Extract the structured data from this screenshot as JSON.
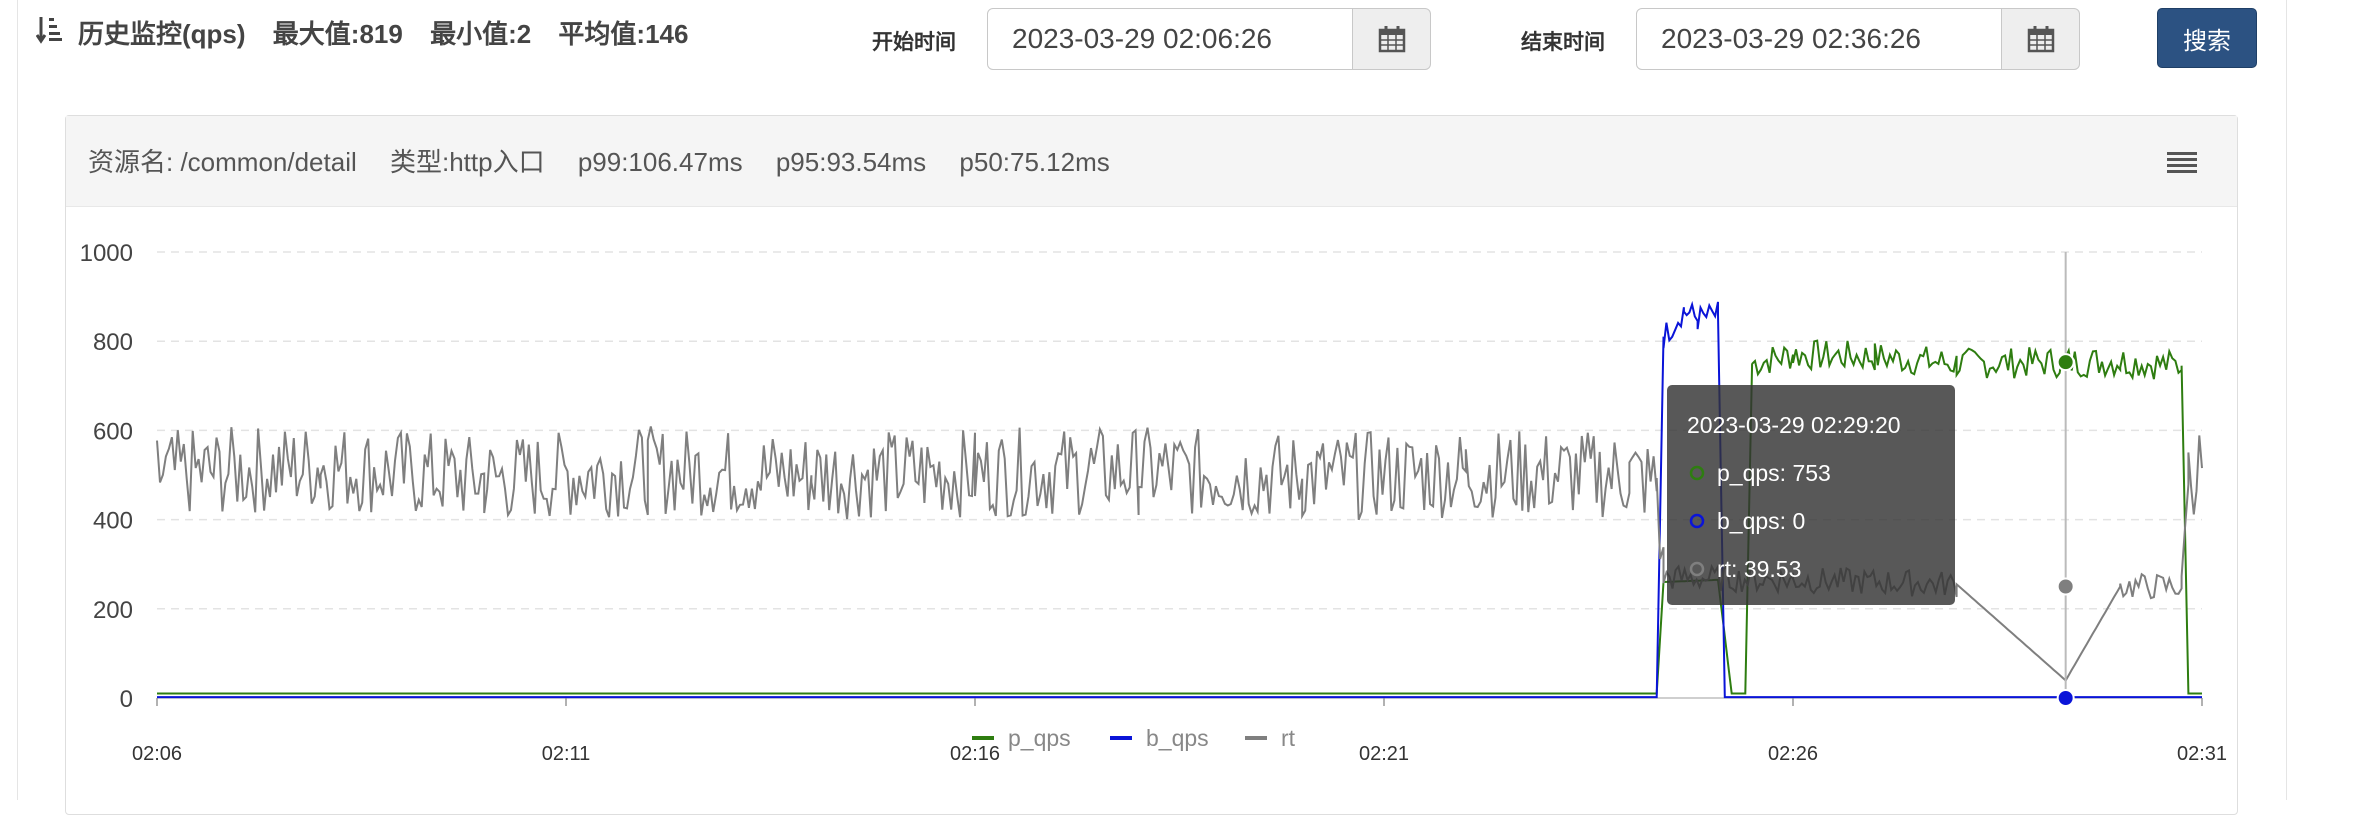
{
  "header": {
    "title": "历史监控(qps)",
    "max_label": "最大值:819",
    "min_label": "最小值:2",
    "avg_label": "平均值:146"
  },
  "filters": {
    "start_label": "开始时间",
    "start_value": "2023-03-29 02:06:26",
    "end_label": "结束时间",
    "end_value": "2023-03-29 02:36:26",
    "search_label": "搜索"
  },
  "card": {
    "resource": "资源名: /common/detail",
    "type": "类型:http入口",
    "p99": "p99:106.47ms",
    "p95": "p95:93.54ms",
    "p50": "p50:75.12ms"
  },
  "icons": {
    "sort": "sort-icon",
    "calendar": "calendar-icon",
    "menu": "hamburger-menu-icon"
  },
  "chart_data": {
    "type": "line",
    "x_ticks": [
      "02:06",
      "02:11",
      "02:16",
      "02:21",
      "02:26",
      "02:31"
    ],
    "y_ticks": [
      "0",
      "200",
      "400",
      "600",
      "800",
      "1000"
    ],
    "ylim": [
      0,
      1000
    ],
    "grid": true,
    "legend_position": "bottom-center",
    "series": [
      {
        "name": "p_qps",
        "color": "#2e7d10",
        "points": [
          [
            "02:06",
            10
          ],
          [
            "02:24:20",
            10
          ],
          [
            "02:24:25",
            260
          ],
          [
            "02:25:05",
            265
          ],
          [
            "02:25:15",
            10
          ],
          [
            "02:25:25",
            10
          ],
          [
            "02:25:30",
            750
          ],
          [
            "02:26:00",
            770
          ],
          [
            "02:27:00",
            765
          ],
          [
            "02:28:00",
            750
          ],
          [
            "02:29:20",
            753
          ],
          [
            "02:30:00",
            755
          ],
          [
            "02:30:45",
            745
          ],
          [
            "02:30:50",
            10
          ],
          [
            "02:31",
            10
          ]
        ]
      },
      {
        "name": "b_qps",
        "color": "#0a14d8",
        "points": [
          [
            "02:06",
            2
          ],
          [
            "02:24:20",
            2
          ],
          [
            "02:24:25",
            810
          ],
          [
            "02:24:40",
            870
          ],
          [
            "02:24:50",
            850
          ],
          [
            "02:25:05",
            860
          ],
          [
            "02:25:10",
            2
          ],
          [
            "02:31",
            2
          ]
        ]
      },
      {
        "name": "rt",
        "color": "#7f7f7f",
        "points": [
          [
            "02:06",
            500
          ],
          [
            "02:08",
            520
          ],
          [
            "02:10",
            490
          ],
          [
            "02:12",
            510
          ],
          [
            "02:14",
            500
          ],
          [
            "02:16",
            505
          ],
          [
            "02:18",
            510
          ],
          [
            "02:20",
            495
          ],
          [
            "02:22",
            505
          ],
          [
            "02:24",
            500
          ],
          [
            "02:24:20",
            480
          ],
          [
            "02:24:25",
            270
          ],
          [
            "02:26",
            265
          ],
          [
            "02:28",
            255
          ],
          [
            "02:29:20",
            39.53
          ],
          [
            "02:30",
            250
          ],
          [
            "02:30:45",
            250
          ],
          [
            "02:30:50",
            500
          ],
          [
            "02:31",
            520
          ]
        ]
      }
    ],
    "tooltip": {
      "time": "2023-03-29 02:29:20",
      "rows": [
        "p_qps: 753",
        "b_qps: 0",
        "rt: 39.53"
      ]
    }
  }
}
